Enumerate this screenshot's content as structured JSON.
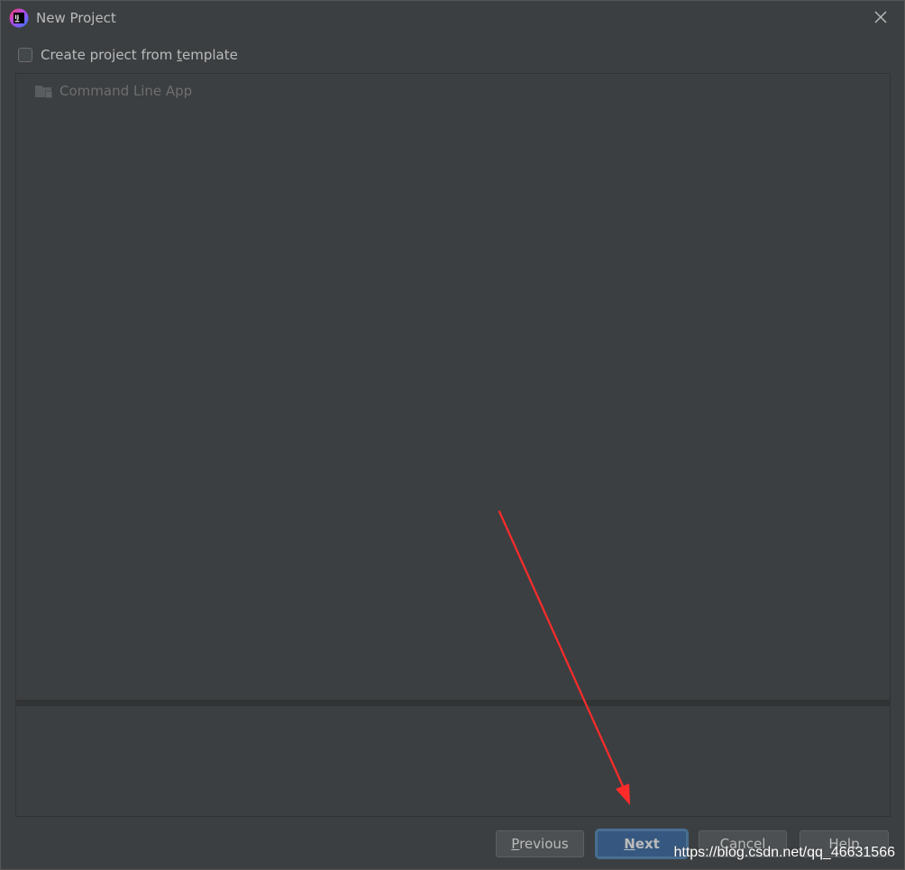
{
  "window": {
    "title": "New Project",
    "app_icon": "intellij-idea-icon",
    "close_icon": "close-icon"
  },
  "template_option": {
    "label_before": "Create project from ",
    "label_mnemonic": "t",
    "label_after": "emplate",
    "checked": false
  },
  "template_list": {
    "items": [
      {
        "label": "Command Line App",
        "icon": "folder-icon",
        "enabled": false
      }
    ]
  },
  "buttons": {
    "previous": {
      "mnemonic": "P",
      "rest": "revious"
    },
    "next": {
      "mnemonic": "N",
      "rest": "ext"
    },
    "cancel": {
      "text": "Cancel"
    },
    "help": {
      "text": "Help"
    }
  },
  "watermark": "https://blog.csdn.net/qq_46631566",
  "colors": {
    "background": "#3c3f41",
    "text": "#bbbbbb",
    "disabled_text": "#6e6e6e",
    "primary_button": "#365880",
    "annotation_arrow": "#ff2b2b"
  }
}
